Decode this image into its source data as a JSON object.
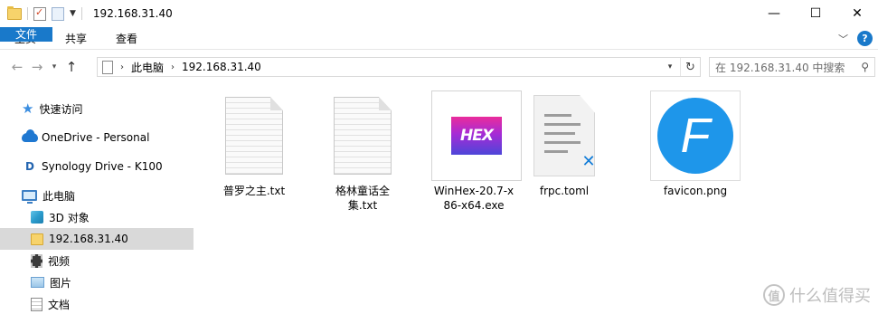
{
  "window": {
    "title": "192.168.31.40",
    "minimize": "—",
    "maximize": "☐",
    "close": "✕"
  },
  "ribbon": {
    "tabs": [
      "文件",
      "主页",
      "共享",
      "查看"
    ]
  },
  "address": {
    "crumbs": [
      "此电脑",
      "192.168.31.40"
    ],
    "search_placeholder": "在 192.168.31.40 中搜索"
  },
  "sidebar": {
    "items": [
      {
        "label": "快速访问",
        "icon": "star-icon"
      },
      {
        "label": "OneDrive - Personal",
        "icon": "onedrive-cloud-icon"
      },
      {
        "label": "Synology Drive - K100",
        "icon": "synology-drive-icon"
      },
      {
        "label": "此电脑",
        "icon": "computer-icon"
      },
      {
        "label": "3D 对象",
        "icon": "3d-objects-icon"
      },
      {
        "label": "192.168.31.40",
        "icon": "folder-icon",
        "selected": true
      },
      {
        "label": "视频",
        "icon": "video-icon"
      },
      {
        "label": "图片",
        "icon": "pictures-icon"
      },
      {
        "label": "文档",
        "icon": "documents-icon"
      }
    ]
  },
  "files": [
    {
      "name": "普罗之主.txt",
      "icon": "text-file-icon"
    },
    {
      "name": "格林童话全集.txt",
      "icon": "text-file-icon"
    },
    {
      "name": "WinHex-20.7-x86-x64.exe",
      "icon": "winhex-app-icon"
    },
    {
      "name": "frpc.toml",
      "icon": "toml-file-icon"
    },
    {
      "name": "favicon.png",
      "icon": "favicon-image-icon"
    }
  ],
  "winhex_logo_text": "HEX",
  "favicon_letter": "F",
  "watermark": {
    "text": "什么值得买",
    "logo_text": "值"
  },
  "colors": {
    "accent": "#1979ca",
    "selection": "#d9d9d9",
    "favicon_blue": "#1e96ea"
  }
}
